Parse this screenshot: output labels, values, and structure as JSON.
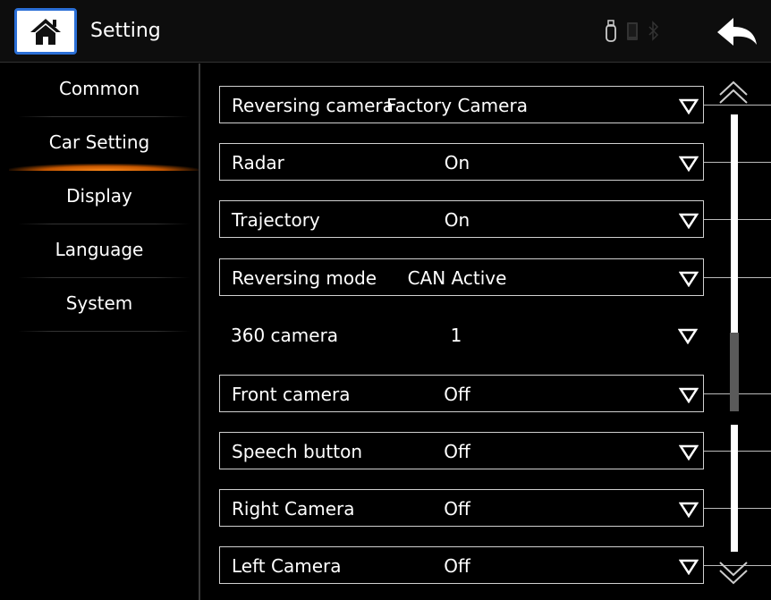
{
  "header": {
    "title": "Setting",
    "status_icons": [
      "usb-icon",
      "phone-icon",
      "bluetooth-icon"
    ],
    "home_icon": "home-icon",
    "back_icon": "back-arrow-icon"
  },
  "sidebar": {
    "active": "Car Setting",
    "items": [
      {
        "label": "Common"
      },
      {
        "label": "Car Setting"
      },
      {
        "label": "Display"
      },
      {
        "label": "Language"
      },
      {
        "label": "System"
      }
    ]
  },
  "settings": [
    {
      "label": "Reversing camera",
      "value": "Factory Camera"
    },
    {
      "label": "Radar",
      "value": "On"
    },
    {
      "label": "Trajectory",
      "value": "On"
    },
    {
      "label": "Reversing mode",
      "value": "CAN Active"
    },
    {
      "label": "360 camera",
      "value": "1"
    },
    {
      "label": "Front camera",
      "value": "Off"
    },
    {
      "label": "Speech button",
      "value": "Off"
    },
    {
      "label": "Right Camera",
      "value": "Off"
    },
    {
      "label": "Left Camera",
      "value": "Off"
    }
  ],
  "colors": {
    "accent_active": "#ff8a1a",
    "home_border": "#2b6fd6",
    "background": "#000000"
  }
}
